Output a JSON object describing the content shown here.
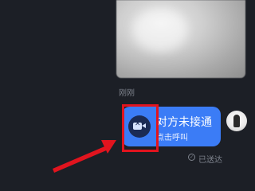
{
  "chat": {
    "timestamp": "刚刚",
    "call_message": {
      "title": "对方未接通",
      "subtitle": "点击呼叫",
      "icon": "video-camera-off-icon"
    },
    "status": {
      "icon": "sent-check-icon",
      "label": "已送达"
    }
  },
  "annotation": {
    "highlight_color": "#e1141e",
    "arrow_color": "#e1141e"
  },
  "colors": {
    "background": "#1c1f26",
    "bubble": "#3b7cf6"
  }
}
